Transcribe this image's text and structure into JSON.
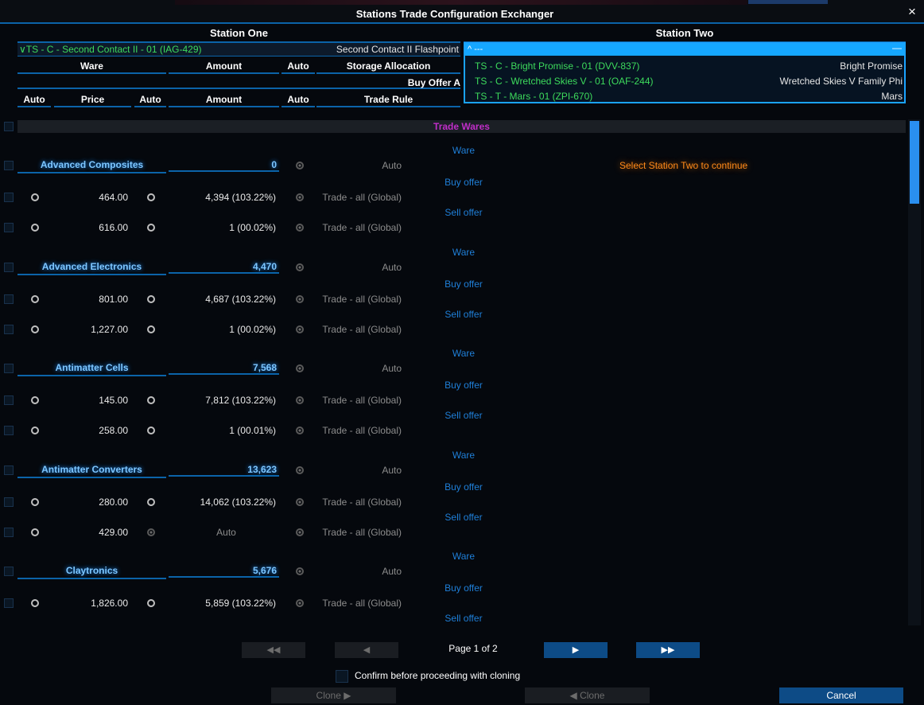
{
  "window": {
    "title": "Stations Trade Configuration Exchanger",
    "close_icon": "×"
  },
  "station_one": {
    "header": "Station One",
    "selected": "∨TS - C - Second Contact II - 01 (IAG-429)",
    "selected_name": "Second Contact II Flashpoint"
  },
  "station_two": {
    "header": "Station Two",
    "dropdown_header": "^ ---",
    "dropdown_dash": "—",
    "options": [
      {
        "label": "TS - C - Bright Promise - 01 (DVV-837)",
        "name": "Bright Promise"
      },
      {
        "label": "TS - C - Wretched Skies V - 01 (OAF-244)",
        "name": "Wretched Skies V Family Phi"
      },
      {
        "label": "TS - T - Mars - 01 (ZPI-670)",
        "name": "Mars"
      }
    ],
    "prompt": "Select Station Two to continue"
  },
  "columns": {
    "ware": "Ware",
    "amount": "Amount",
    "auto": "Auto",
    "storage": "Storage Allocation",
    "buy_offer": "Buy Offer A",
    "auto2": "Auto",
    "price": "Price",
    "auto3": "Auto",
    "amount2": "Amount",
    "auto4": "Auto",
    "trade_rule": "Trade Rule"
  },
  "section": "Trade Wares",
  "labels": {
    "ware": "Ware",
    "buy": "Buy offer",
    "sell": "Sell offer"
  },
  "wares": [
    {
      "name": "Advanced Composites",
      "amount": "0",
      "auto": "Auto",
      "buy": {
        "price": "464.00",
        "amount": "4,394 (103.22%)",
        "rule": "Trade - all (Global)"
      },
      "sell": {
        "price": "616.00",
        "amount": "1 (00.02%)",
        "rule": "Trade - all (Global)"
      }
    },
    {
      "name": "Advanced Electronics",
      "amount": "4,470",
      "auto": "Auto",
      "buy": {
        "price": "801.00",
        "amount": "4,687 (103.22%)",
        "rule": "Trade - all (Global)"
      },
      "sell": {
        "price": "1,227.00",
        "amount": "1 (00.02%)",
        "rule": "Trade - all (Global)"
      }
    },
    {
      "name": "Antimatter Cells",
      "amount": "7,568",
      "auto": "Auto",
      "buy": {
        "price": "145.00",
        "amount": "7,812 (103.22%)",
        "rule": "Trade - all (Global)"
      },
      "sell": {
        "price": "258.00",
        "amount": "1 (00.01%)",
        "rule": "Trade - all (Global)"
      }
    },
    {
      "name": "Antimatter Converters",
      "amount": "13,623",
      "auto": "Auto",
      "buy": {
        "price": "280.00",
        "amount": "14,062 (103.22%)",
        "rule": "Trade - all (Global)"
      },
      "sell": {
        "price": "429.00",
        "amount": "Auto",
        "rule": "Trade - all (Global)"
      }
    },
    {
      "name": "Claytronics",
      "amount": "5,676",
      "auto": "Auto",
      "buy": {
        "price": "1,826.00",
        "amount": "5,859 (103.22%)",
        "rule": "Trade - all (Global)"
      }
    }
  ],
  "pagination": {
    "first": "◀◀",
    "prev": "◀",
    "label": "Page 1 of 2",
    "next": "▶",
    "last": "▶▶"
  },
  "footer": {
    "confirm_label": "Confirm before proceeding with cloning",
    "clone_right": "Clone ▶",
    "clone_left": "◀ Clone",
    "cancel": "Cancel"
  }
}
